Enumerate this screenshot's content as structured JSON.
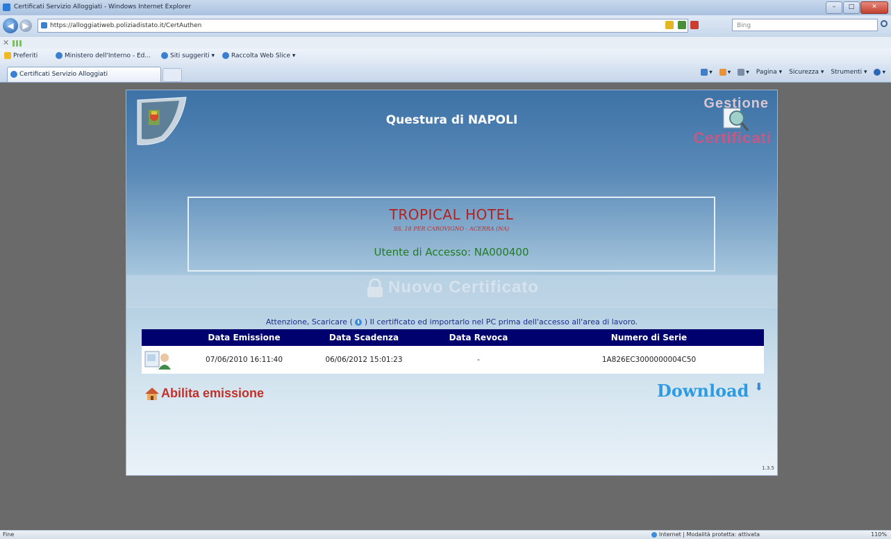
{
  "browser": {
    "window_title": "Certificati Servizio Alloggiati - Windows Internet Explorer",
    "url": "https://alloggiatiweb.poliziadistato.it/CertAuthen",
    "search_placeholder": "Bing",
    "favorites_label": "Preferiti",
    "favorites": [
      "Ministero dell'Interno - Ed...",
      "Siti suggeriti ▾",
      "Raccolta Web Slice ▾"
    ],
    "tab_title": "Certificati Servizio Alloggiati",
    "commands": [
      "Pagina ▾",
      "Sicurezza ▾",
      "Strumenti ▾"
    ],
    "status_left": "Fine",
    "status_zone": "Internet | Modalità protetta: attivata",
    "zoom": "110%"
  },
  "header": {
    "title": "Questura di NAPOLI",
    "logo_line1": "Gestione",
    "logo_line2": "Certificati"
  },
  "hotel": {
    "name": "TROPICAL HOTEL",
    "address": "SS. 18 PER CAROVIGNO - ACERRA (NA)",
    "user": "Utente di Accesso: NA000400"
  },
  "section_title": "Nuovo Certificato",
  "warning": {
    "before": "Attenzione, Scaricare (",
    "after": ") Il certificato ed importarlo nel PC prima dell'accesso all'area di lavoro."
  },
  "table": {
    "headers": [
      "Data Emissione",
      "Data Scadenza",
      "Data Revoca",
      "Numero di Serie"
    ],
    "rows": [
      {
        "emissione": "07/06/2010 16:11:40",
        "scadenza": "06/06/2012 15:01:23",
        "revoca": "-",
        "serie": "1A826EC3000000004C50"
      }
    ]
  },
  "actions": {
    "abilita": "Abilita emissione",
    "download": "Download"
  },
  "version": "1.3.5",
  "colors": {
    "table_header": "#00006e",
    "hotel_name": "#b3201f",
    "user_text": "#1f7d1f",
    "download": "#2d9be2",
    "abilita": "#c1312a"
  }
}
